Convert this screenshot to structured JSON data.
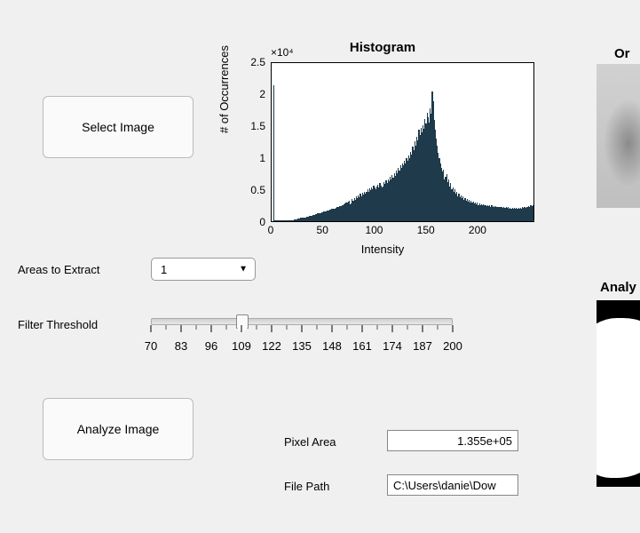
{
  "buttons": {
    "select_image": "Select Image",
    "analyze_image": "Analyze Image"
  },
  "controls": {
    "areas_label": "Areas to Extract",
    "areas_value": "1",
    "filter_label": "Filter Threshold",
    "slider": {
      "min": 70,
      "max": 200,
      "value": 109,
      "major_ticks": [
        70,
        83,
        96,
        109,
        122,
        135,
        148,
        161,
        174,
        187,
        200
      ]
    }
  },
  "outputs": {
    "pixel_area_label": "Pixel Area",
    "pixel_area_value": "1.355e+05",
    "file_path_label": "File Path",
    "file_path_value": "C:\\Users\\danie\\Dow"
  },
  "panels": {
    "original_title_partial": "Or",
    "analyzed_title_partial": "Analy"
  },
  "chart_data": {
    "type": "bar",
    "title": "Histogram",
    "xlabel": "Intensity",
    "ylabel": "# of Occurrences",
    "y_exponent_label": "×10⁴",
    "xlim": [
      0,
      255
    ],
    "ylim": [
      0,
      2.5
    ],
    "xticks": [
      0,
      50,
      100,
      150,
      200
    ],
    "yticks": [
      0,
      0.5,
      1,
      1.5,
      2,
      2.5
    ],
    "values_unit": "×10^4 occurrences",
    "bins": [
      0.0,
      0.0,
      2.15,
      0.02,
      0.02,
      0.02,
      0.02,
      0.02,
      0.02,
      0.02,
      0.02,
      0.02,
      0.02,
      0.02,
      0.02,
      0.02,
      0.02,
      0.02,
      0.02,
      0.02,
      0.02,
      0.02,
      0.03,
      0.03,
      0.03,
      0.04,
      0.04,
      0.04,
      0.05,
      0.05,
      0.05,
      0.06,
      0.06,
      0.06,
      0.07,
      0.07,
      0.08,
      0.08,
      0.09,
      0.09,
      0.1,
      0.1,
      0.11,
      0.11,
      0.12,
      0.12,
      0.13,
      0.13,
      0.14,
      0.14,
      0.15,
      0.15,
      0.16,
      0.16,
      0.17,
      0.17,
      0.18,
      0.18,
      0.19,
      0.19,
      0.2,
      0.2,
      0.21,
      0.22,
      0.22,
      0.23,
      0.24,
      0.24,
      0.25,
      0.26,
      0.27,
      0.28,
      0.29,
      0.3,
      0.31,
      0.32,
      0.27,
      0.28,
      0.35,
      0.32,
      0.37,
      0.34,
      0.39,
      0.36,
      0.41,
      0.38,
      0.43,
      0.4,
      0.45,
      0.42,
      0.47,
      0.44,
      0.46,
      0.5,
      0.47,
      0.52,
      0.49,
      0.54,
      0.51,
      0.56,
      0.53,
      0.5,
      0.55,
      0.58,
      0.54,
      0.6,
      0.56,
      0.53,
      0.55,
      0.62,
      0.59,
      0.64,
      0.6,
      0.66,
      0.63,
      0.7,
      0.66,
      0.73,
      0.69,
      0.76,
      0.72,
      0.8,
      0.76,
      0.84,
      0.8,
      0.88,
      0.84,
      0.92,
      0.88,
      0.96,
      0.92,
      1.0,
      0.96,
      1.04,
      1.0,
      1.1,
      1.06,
      1.18,
      1.12,
      1.26,
      1.2,
      1.34,
      1.28,
      1.44,
      1.36,
      1.48,
      1.4,
      1.52,
      1.46,
      1.62,
      1.55,
      1.72,
      1.64,
      1.56,
      1.78,
      1.7,
      2.05,
      1.9,
      1.6,
      1.45,
      1.3,
      1.2,
      1.08,
      1.0,
      0.92,
      0.84,
      0.78,
      0.82,
      0.66,
      0.7,
      0.74,
      0.62,
      0.66,
      0.55,
      0.6,
      0.5,
      0.54,
      0.46,
      0.5,
      0.43,
      0.47,
      0.4,
      0.44,
      0.38,
      0.41,
      0.36,
      0.39,
      0.34,
      0.37,
      0.33,
      0.35,
      0.31,
      0.34,
      0.3,
      0.32,
      0.29,
      0.31,
      0.28,
      0.3,
      0.27,
      0.29,
      0.26,
      0.28,
      0.26,
      0.27,
      0.25,
      0.27,
      0.25,
      0.26,
      0.24,
      0.26,
      0.24,
      0.25,
      0.23,
      0.25,
      0.23,
      0.24,
      0.23,
      0.24,
      0.22,
      0.23,
      0.22,
      0.23,
      0.22,
      0.23,
      0.21,
      0.22,
      0.21,
      0.22,
      0.21,
      0.22,
      0.2,
      0.21,
      0.2,
      0.21,
      0.2,
      0.21,
      0.2,
      0.21,
      0.2,
      0.21,
      0.2,
      0.21,
      0.2,
      0.22,
      0.21,
      0.22,
      0.21,
      0.23,
      0.22,
      0.24,
      0.23,
      0.25,
      0.24,
      0.26,
      0.02
    ]
  }
}
